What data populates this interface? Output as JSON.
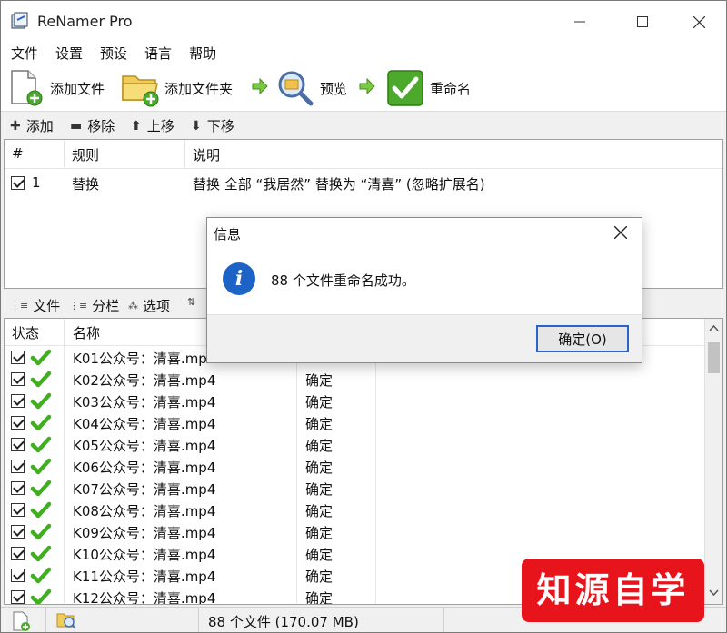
{
  "window": {
    "title": "ReNamer Pro"
  },
  "menu": [
    "文件",
    "设置",
    "预设",
    "语言",
    "帮助"
  ],
  "toolbar": {
    "add_files": "添加文件",
    "add_folders": "添加文件夹",
    "preview": "预览",
    "rename": "重命名"
  },
  "rules_toolbar": {
    "add": "添加",
    "remove": "移除",
    "up": "上移",
    "down": "下移"
  },
  "rules_table": {
    "headers": {
      "num": "#",
      "rule": "规则",
      "desc": "说明"
    },
    "rows": [
      {
        "num": "1",
        "rule": "替换",
        "desc": "替换 全部 “我居然” 替换为 “清喜” (忽略扩展名)"
      }
    ]
  },
  "files_toolbar": {
    "files": "文件",
    "columns": "分栏",
    "options": "选项"
  },
  "files_table": {
    "headers": {
      "status": "状态",
      "name": "名称"
    },
    "rows": [
      {
        "name": "K01公众号：清喜.mp4",
        "state": ""
      },
      {
        "name": "K02公众号：清喜.mp4",
        "state": "确定"
      },
      {
        "name": "K03公众号：清喜.mp4",
        "state": "确定"
      },
      {
        "name": "K04公众号：清喜.mp4",
        "state": "确定"
      },
      {
        "name": "K05公众号：清喜.mp4",
        "state": "确定"
      },
      {
        "name": "K06公众号：清喜.mp4",
        "state": "确定"
      },
      {
        "name": "K07公众号：清喜.mp4",
        "state": "确定"
      },
      {
        "name": "K08公众号：清喜.mp4",
        "state": "确定"
      },
      {
        "name": "K09公众号：清喜.mp4",
        "state": "确定"
      },
      {
        "name": "K10公众号：清喜.mp4",
        "state": "确定"
      },
      {
        "name": "K11公众号：清喜.mp4",
        "state": "确定"
      },
      {
        "name": "K12公众号：清喜.mp4",
        "state": "确定"
      }
    ]
  },
  "status_bar": {
    "summary": "88 个文件 (170.07 MB)"
  },
  "dialog": {
    "title": "信息",
    "message": "88 个文件重命名成功。",
    "ok_label": "确定(O)"
  },
  "watermark": {
    "text": "知源自学堂"
  },
  "colors": {
    "accent": "#2a64c8",
    "info": "#1d63c5",
    "check_green": "#3fae1f",
    "watermark_red": "#e8141b"
  }
}
